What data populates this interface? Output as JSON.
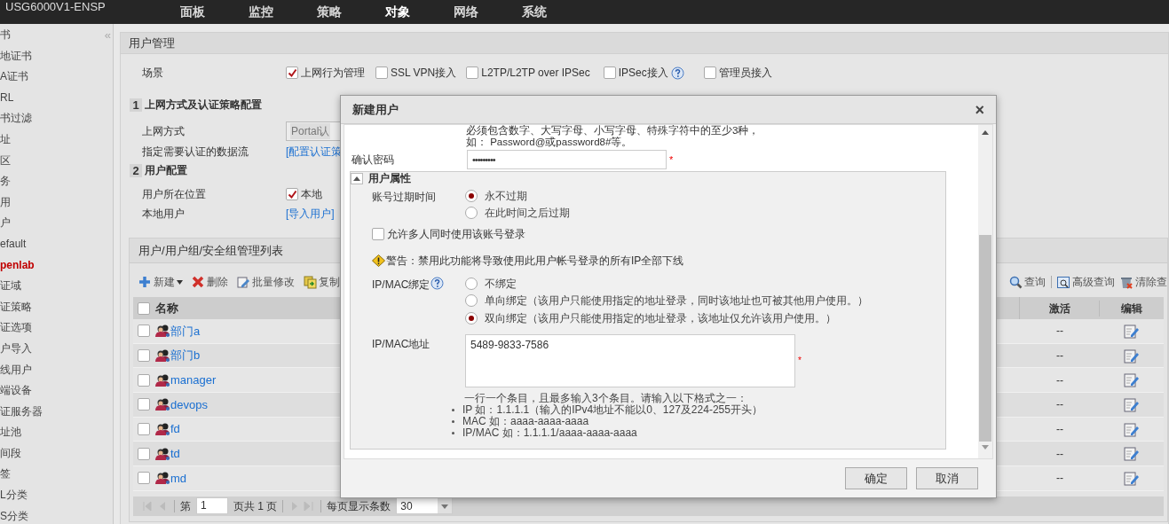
{
  "app": {
    "title": "USG6000V1-ENSP",
    "nav": [
      {
        "label": "面板",
        "selected": false
      },
      {
        "label": "监控",
        "selected": false
      },
      {
        "label": "策略",
        "selected": false
      },
      {
        "label": "对象",
        "selected": true
      },
      {
        "label": "网络",
        "selected": false
      },
      {
        "label": "系统",
        "selected": false
      }
    ]
  },
  "sidebar": {
    "collapse": "«",
    "items": [
      {
        "label": "书",
        "selected": false
      },
      {
        "label": "地证书",
        "selected": false
      },
      {
        "label": "A证书",
        "selected": false
      },
      {
        "label": "RL",
        "selected": false
      },
      {
        "label": "书过滤",
        "selected": false
      },
      {
        "label": "址",
        "selected": false
      },
      {
        "label": "区",
        "selected": false
      },
      {
        "label": "务",
        "selected": false
      },
      {
        "label": "用",
        "selected": false
      },
      {
        "label": "户",
        "selected": false
      },
      {
        "label": "efault",
        "selected": false
      },
      {
        "label": "penlab",
        "selected": true
      },
      {
        "label": "证域",
        "selected": false
      },
      {
        "label": "证策略",
        "selected": false
      },
      {
        "label": "证选项",
        "selected": false
      },
      {
        "label": "户导入",
        "selected": false
      },
      {
        "label": "线用户",
        "selected": false
      },
      {
        "label": "端设备",
        "selected": false
      },
      {
        "label": "证服务器",
        "selected": false
      },
      {
        "label": "址池",
        "selected": false
      },
      {
        "label": "间段",
        "selected": false
      },
      {
        "label": "签",
        "selected": false
      },
      {
        "label": "L分类",
        "selected": false
      },
      {
        "label": "S分类",
        "selected": false
      }
    ]
  },
  "page": {
    "title": "用户管理",
    "scene": {
      "label": "场景",
      "options": [
        {
          "label": "上网行为管理",
          "checked": true,
          "help": false
        },
        {
          "label": "SSL VPN接入",
          "checked": false,
          "help": false
        },
        {
          "label": "L2TP/L2TP over IPSec",
          "checked": false,
          "help": false
        },
        {
          "label": "IPSec接入",
          "checked": false,
          "help": true
        },
        {
          "label": "管理员接入",
          "checked": false,
          "help": false
        }
      ]
    },
    "section_1": {
      "number": "1",
      "title": "上网方式及认证策略配置",
      "access_label": "上网方式",
      "access_value": "Portal认",
      "flow_label": "指定需要认证的数据流",
      "flow_link": "[配置认证策"
    },
    "section_2": {
      "number": "2",
      "title": "用户配置",
      "location_label": "用户所在位置",
      "location_option": {
        "label": "本地",
        "checked": true
      },
      "local_label": "本地用户",
      "local_link": "[导入用户]"
    },
    "list": {
      "title": "用户/用户组/安全组管理列表",
      "toolbar_left": [
        {
          "kind": "new",
          "label": "新建"
        },
        {
          "kind": "delete",
          "label": "删除"
        },
        {
          "kind": "batch",
          "label": "批量修改"
        },
        {
          "kind": "copy",
          "label": "复制"
        }
      ],
      "toolbar_right": [
        {
          "kind": "search",
          "label": "查询"
        },
        {
          "kind": "advanced",
          "label": "高级查询"
        },
        {
          "kind": "clear",
          "label": "清除查"
        }
      ],
      "columns": [
        "名称",
        "激活",
        "编辑"
      ],
      "select_all_checked": false,
      "rows": [
        {
          "name": "部门a",
          "active": "--",
          "checked": false
        },
        {
          "name": "部门b",
          "active": "--",
          "checked": false
        },
        {
          "name": "manager",
          "active": "--",
          "checked": false
        },
        {
          "name": "devops",
          "active": "--",
          "checked": false
        },
        {
          "name": "fd",
          "active": "--",
          "checked": false
        },
        {
          "name": "td",
          "active": "--",
          "checked": false
        },
        {
          "name": "md",
          "active": "--",
          "checked": false
        }
      ],
      "pager": {
        "page_prefix": "第",
        "page": "1",
        "page_suffix": "页共 1 页",
        "per_page_label": "每页显示条数",
        "per_page": "30"
      }
    }
  },
  "dialog": {
    "title": "新建用户",
    "close": "×",
    "password_hint": [
      "必须包含数字、大写字母、小写字母、特殊字符中的至少3种，",
      "如： Password@或password8#等。"
    ],
    "confirm_label": "确认密码",
    "confirm_value": "•••••••••",
    "required_mark": "*",
    "section": {
      "title": "用户属性",
      "expanded": true
    },
    "expiry": {
      "label": "账号过期时间",
      "options": [
        {
          "label": "永不过期",
          "selected": true
        },
        {
          "label": "在此时间之后过期",
          "selected": false
        }
      ]
    },
    "multi_login": {
      "label": "允许多人同时使用该账号登录",
      "checked": false
    },
    "warning": "警告：禁用此功能将导致使用此用户帐号登录的所有IP全部下线",
    "binding": {
      "label": "IP/MAC绑定",
      "options": [
        {
          "label": "不绑定",
          "selected": false
        },
        {
          "label": "单向绑定（该用户只能使用指定的地址登录，同时该地址也可被其他用户使用。）",
          "selected": false
        },
        {
          "label": "双向绑定（该用户只能使用指定的地址登录，该地址仅允许该用户使用。）",
          "selected": true
        }
      ]
    },
    "address": {
      "label": "IP/MAC地址",
      "value": "5489-9833-7586"
    },
    "help": "一行一个条目，且最多输入3个条目。请输入以下格式之一：",
    "formats": [
      "IP 如：1.1.1.1（输入的IPv4地址不能以0、127及224-255开头）",
      "MAC 如：aaaa-aaaa-aaaa",
      "IP/MAC 如：1.1.1.1/aaaa-aaaa-aaaa"
    ],
    "buttons": [
      "确定",
      "取消"
    ]
  }
}
